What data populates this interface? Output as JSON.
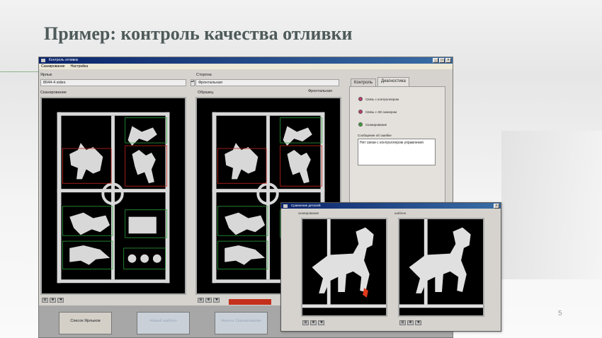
{
  "slide": {
    "title": "Пример: контроль качества отливки",
    "page_number": "5"
  },
  "main_window": {
    "title": "Контроль отливок",
    "menu": [
      "Сканирование",
      "Настройка"
    ],
    "label_field": {
      "label": "Ярлык",
      "value": "8044-4 sides"
    },
    "side_field": {
      "label": "Сторона",
      "value": "Фронтальная"
    },
    "scan_caption": "Сканирование",
    "sample_caption": "Образец",
    "sample_side": "Фронтальная",
    "tabs": [
      {
        "label": "Контроль",
        "active": false
      },
      {
        "label": "Диагностика",
        "active": true
      }
    ],
    "diagnostics": {
      "leds": [
        {
          "label": "Связь с контроллером",
          "color": "#c23a6e"
        },
        {
          "label": "Связь с 3D сканером",
          "color": "#c23a6e"
        },
        {
          "label": "Сканирование",
          "color": "#3aa23a"
        }
      ],
      "error_label": "Сообщение об ошибке",
      "error_text": "Нет связи с контроллером управления"
    },
    "buttons": [
      {
        "label": "Список Ярлыков",
        "enabled": true
      },
      {
        "label": "Новый шаблон",
        "enabled": false
      },
      {
        "label": "Начать Сканирование",
        "enabled": false
      }
    ]
  },
  "compare_window": {
    "title": "Сравнение деталей",
    "left_label": "сканирование",
    "right_label": "шаблон"
  }
}
